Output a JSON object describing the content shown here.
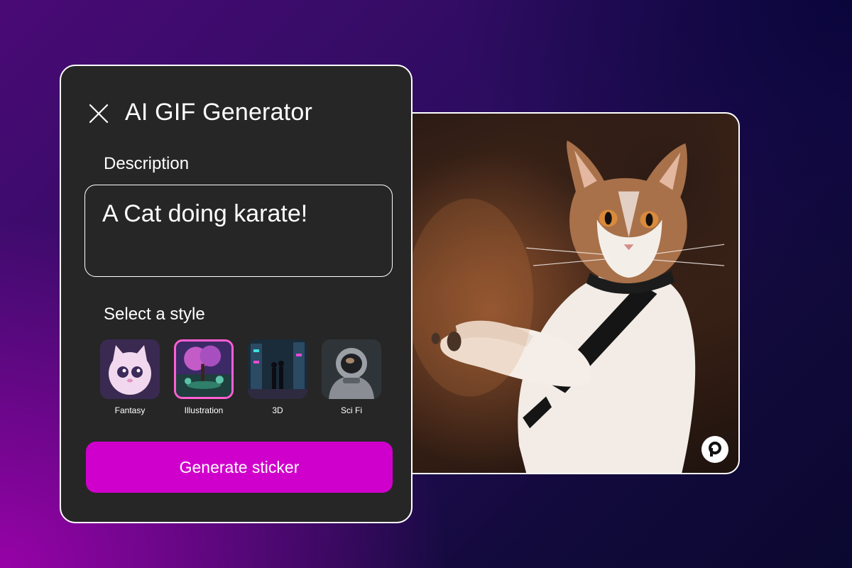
{
  "panel": {
    "title": "AI GIF Generator",
    "description_label": "Description",
    "description_value": "A Cat doing karate!",
    "style_label": "Select a style",
    "styles": [
      {
        "label": "Fantasy",
        "selected": false
      },
      {
        "label": "Illustration",
        "selected": true
      },
      {
        "label": "3D",
        "selected": false
      },
      {
        "label": "Sci Fi",
        "selected": false
      }
    ],
    "generate_label": "Generate sticker"
  },
  "result": {
    "image_subject": "cat doing karate",
    "watermark_icon": "brand-p-icon"
  },
  "icons": {
    "close": "close-icon"
  },
  "colors": {
    "accent": "#d000cc",
    "selected_outline": "#ff5fd2",
    "panel_bg": "#262626",
    "text": "#ffffff"
  }
}
